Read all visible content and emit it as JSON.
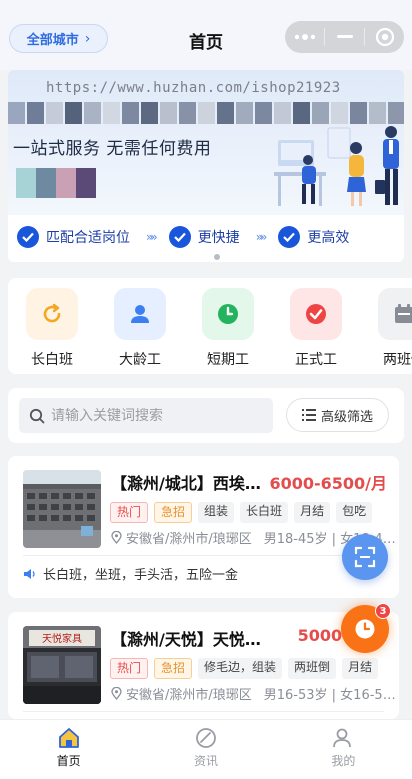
{
  "header": {
    "city_button_label": "全部城市",
    "title": "首页"
  },
  "banner": {
    "watermark": "https://www.huzhan.com/ishop21923",
    "slogan": "一站式服务 无需任何费用",
    "features": [
      {
        "label": "匹配合适岗位"
      },
      {
        "label": "更快捷"
      },
      {
        "label": "更高效"
      }
    ]
  },
  "categories": [
    {
      "label": "长白班",
      "icon": "refresh-icon",
      "color": "#f5a623",
      "bg": "#fff4e3"
    },
    {
      "label": "大龄工",
      "icon": "person-icon",
      "color": "#3b7ff0",
      "bg": "#e6efff"
    },
    {
      "label": "短期工",
      "icon": "clock-icon",
      "color": "#22b35e",
      "bg": "#e3f7eb"
    },
    {
      "label": "正式工",
      "icon": "check-circle-icon",
      "color": "#ef4444",
      "bg": "#ffe6e6"
    },
    {
      "label": "两班倒",
      "icon": "calendar-icon",
      "color": "#888c94",
      "bg": "#f0f1f3"
    }
  ],
  "search": {
    "placeholder": "请输入关键词搜索",
    "filter_label": "高级筛选"
  },
  "jobs": [
    {
      "title": "【滁州/城北】西埃…",
      "salary": "6000-6500/月",
      "tags": [
        {
          "label": "热门",
          "type": "hot"
        },
        {
          "label": "急招",
          "type": "urgent"
        },
        {
          "label": "组装",
          "type": "normal"
        },
        {
          "label": "长白班",
          "type": "normal"
        },
        {
          "label": "月结",
          "type": "normal"
        },
        {
          "label": "包吃",
          "type": "normal"
        }
      ],
      "location": "安徽省/滁州市/琅琊区",
      "requirement": "男18-45岁 | 女18-4…",
      "benefits": "长白班，坐班，手头活，五险一金"
    },
    {
      "title": "【滁州/天悦】天悦…",
      "salary": "5000-55…",
      "tags": [
        {
          "label": "热门",
          "type": "hot"
        },
        {
          "label": "急招",
          "type": "urgent"
        },
        {
          "label": "修毛边，组装",
          "type": "normal"
        },
        {
          "label": "两班倒",
          "type": "normal"
        },
        {
          "label": "月结",
          "type": "normal"
        }
      ],
      "location": "安徽省/滁州市/琅琊区",
      "requirement": "男16-53岁 | 女16-5…",
      "sign_text": "天悦家具"
    }
  ],
  "floating": {
    "notification_count": "3"
  },
  "tabbar": [
    {
      "label": "首页",
      "icon": "home-icon",
      "active": true
    },
    {
      "label": "资讯",
      "icon": "news-icon",
      "active": false
    },
    {
      "label": "我的",
      "icon": "user-icon",
      "active": false
    }
  ],
  "colors": {
    "primary": "#1a56db",
    "salary": "#e54d4d",
    "accent_orange": "#f97316"
  }
}
